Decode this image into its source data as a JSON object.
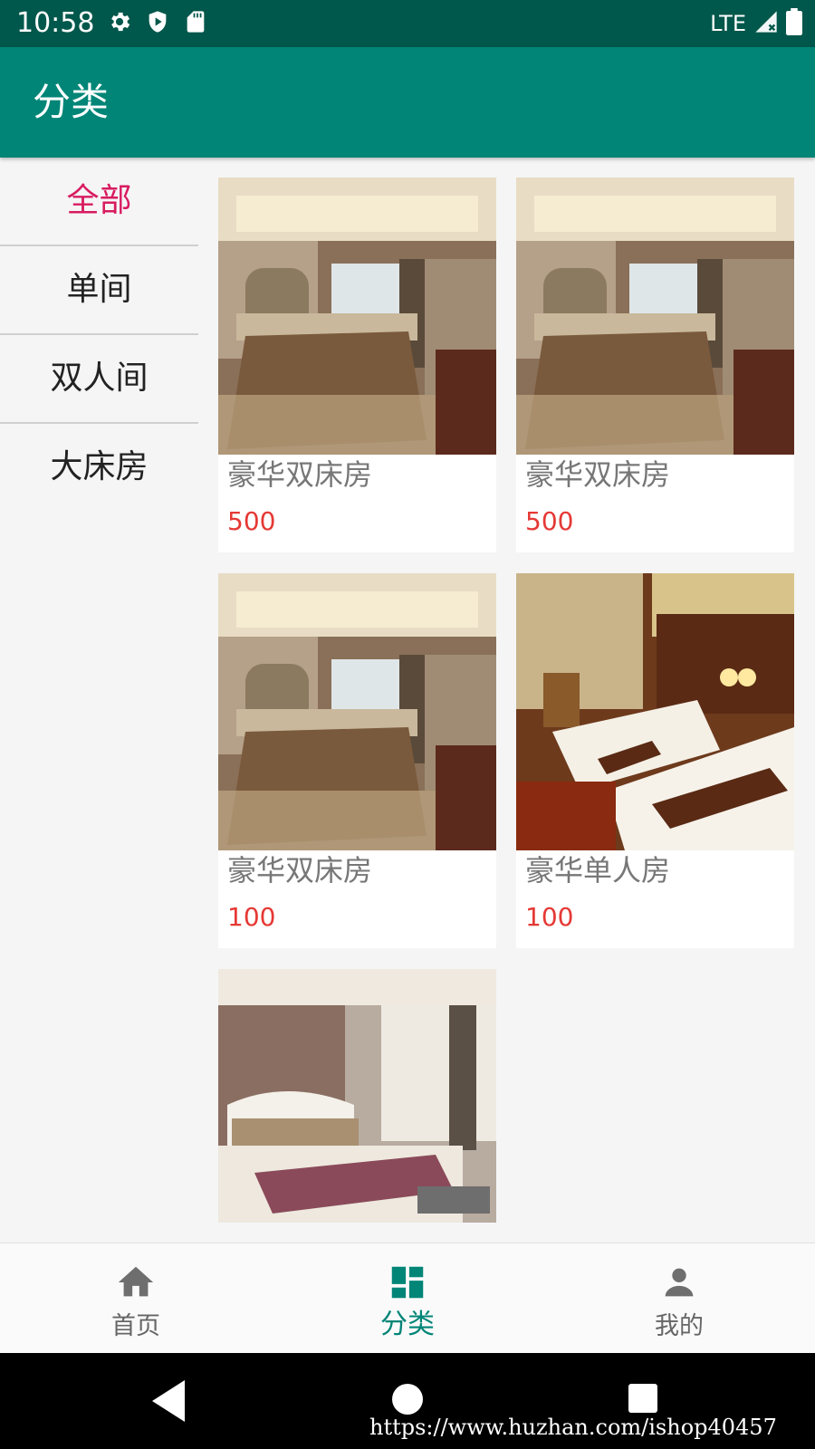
{
  "status_bar": {
    "time": "10:58",
    "network": "LTE",
    "icons": [
      "settings-icon",
      "shield-icon",
      "sd-card-icon",
      "signal-icon",
      "battery-icon"
    ]
  },
  "app_bar": {
    "title": "分类"
  },
  "sidebar": {
    "items": [
      {
        "label": "全部",
        "active": true
      },
      {
        "label": "单间",
        "active": false
      },
      {
        "label": "双人间",
        "active": false
      },
      {
        "label": "大床房",
        "active": false
      }
    ]
  },
  "rooms": [
    {
      "name": "豪华双床房",
      "price": "500"
    },
    {
      "name": "豪华双床房",
      "price": "500"
    },
    {
      "name": "豪华双床房",
      "price": "100"
    },
    {
      "name": "豪华单人房",
      "price": "100"
    }
  ],
  "bottom_nav": {
    "items": [
      {
        "label": "首页",
        "icon": "home-icon",
        "active": false
      },
      {
        "label": "分类",
        "icon": "dashboard-icon",
        "active": true
      },
      {
        "label": "我的",
        "icon": "person-icon",
        "active": false
      }
    ]
  },
  "system_nav": {
    "icons": [
      "back-icon",
      "home-circle-icon",
      "recents-icon"
    ]
  },
  "watermark": "https://www.huzhan.com/ishop40457",
  "colors": {
    "status_bar": "#00574b",
    "app_bar": "#008577",
    "accent_active_sidebar": "#d81b60",
    "price": "#e53935",
    "nav_active": "#008577"
  }
}
